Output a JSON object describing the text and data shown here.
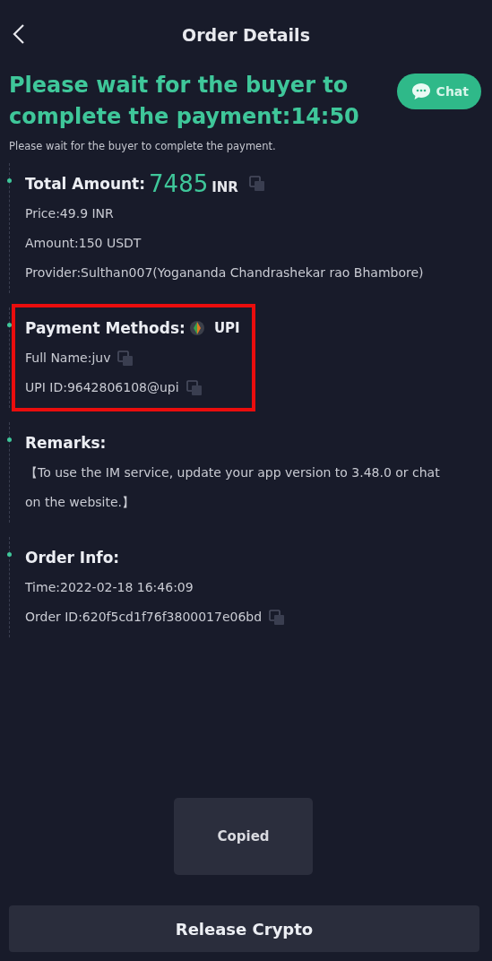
{
  "header": {
    "title": "Order Details"
  },
  "chat_button": {
    "label": "Chat"
  },
  "status": {
    "headline": "Please wait for the buyer to complete the payment:14:50",
    "subtext": "Please wait for the buyer to complete the payment."
  },
  "sections": [
    {
      "kind": "amount",
      "title": "Total Amount:",
      "value": "7485",
      "unit": "INR",
      "copyable": true,
      "highlighted": false,
      "rows": [
        {
          "text": "Price:49.9 INR",
          "copyable": false
        },
        {
          "text": "Amount:150 USDT",
          "copyable": false
        },
        {
          "text": "Provider:Sulthan007(Yogananda Chandrashekar rao Bhambore)",
          "copyable": false
        }
      ]
    },
    {
      "kind": "method",
      "title": "Payment Methods:",
      "value": "UPI",
      "copyable": false,
      "highlighted": true,
      "rows": [
        {
          "text": "Full Name:juv",
          "copyable": true
        },
        {
          "text": "UPI ID:9642806108@upi",
          "copyable": true
        }
      ]
    },
    {
      "kind": "plain",
      "title": "Remarks:",
      "copyable": false,
      "highlighted": false,
      "rows": [
        {
          "text": "【To use the IM service, update your app version to 3.48.0 or chat on the website.】",
          "copyable": false
        }
      ]
    },
    {
      "kind": "plain",
      "title": "Order Info:",
      "copyable": false,
      "highlighted": false,
      "rows": [
        {
          "text": "Time:2022-02-18 16:46:09",
          "copyable": false
        },
        {
          "text": "Order ID:620f5cd1f76f3800017e06bd",
          "copyable": true
        }
      ]
    }
  ],
  "toast": {
    "text": "Copied"
  },
  "action_button": {
    "label": "Release Crypto"
  }
}
